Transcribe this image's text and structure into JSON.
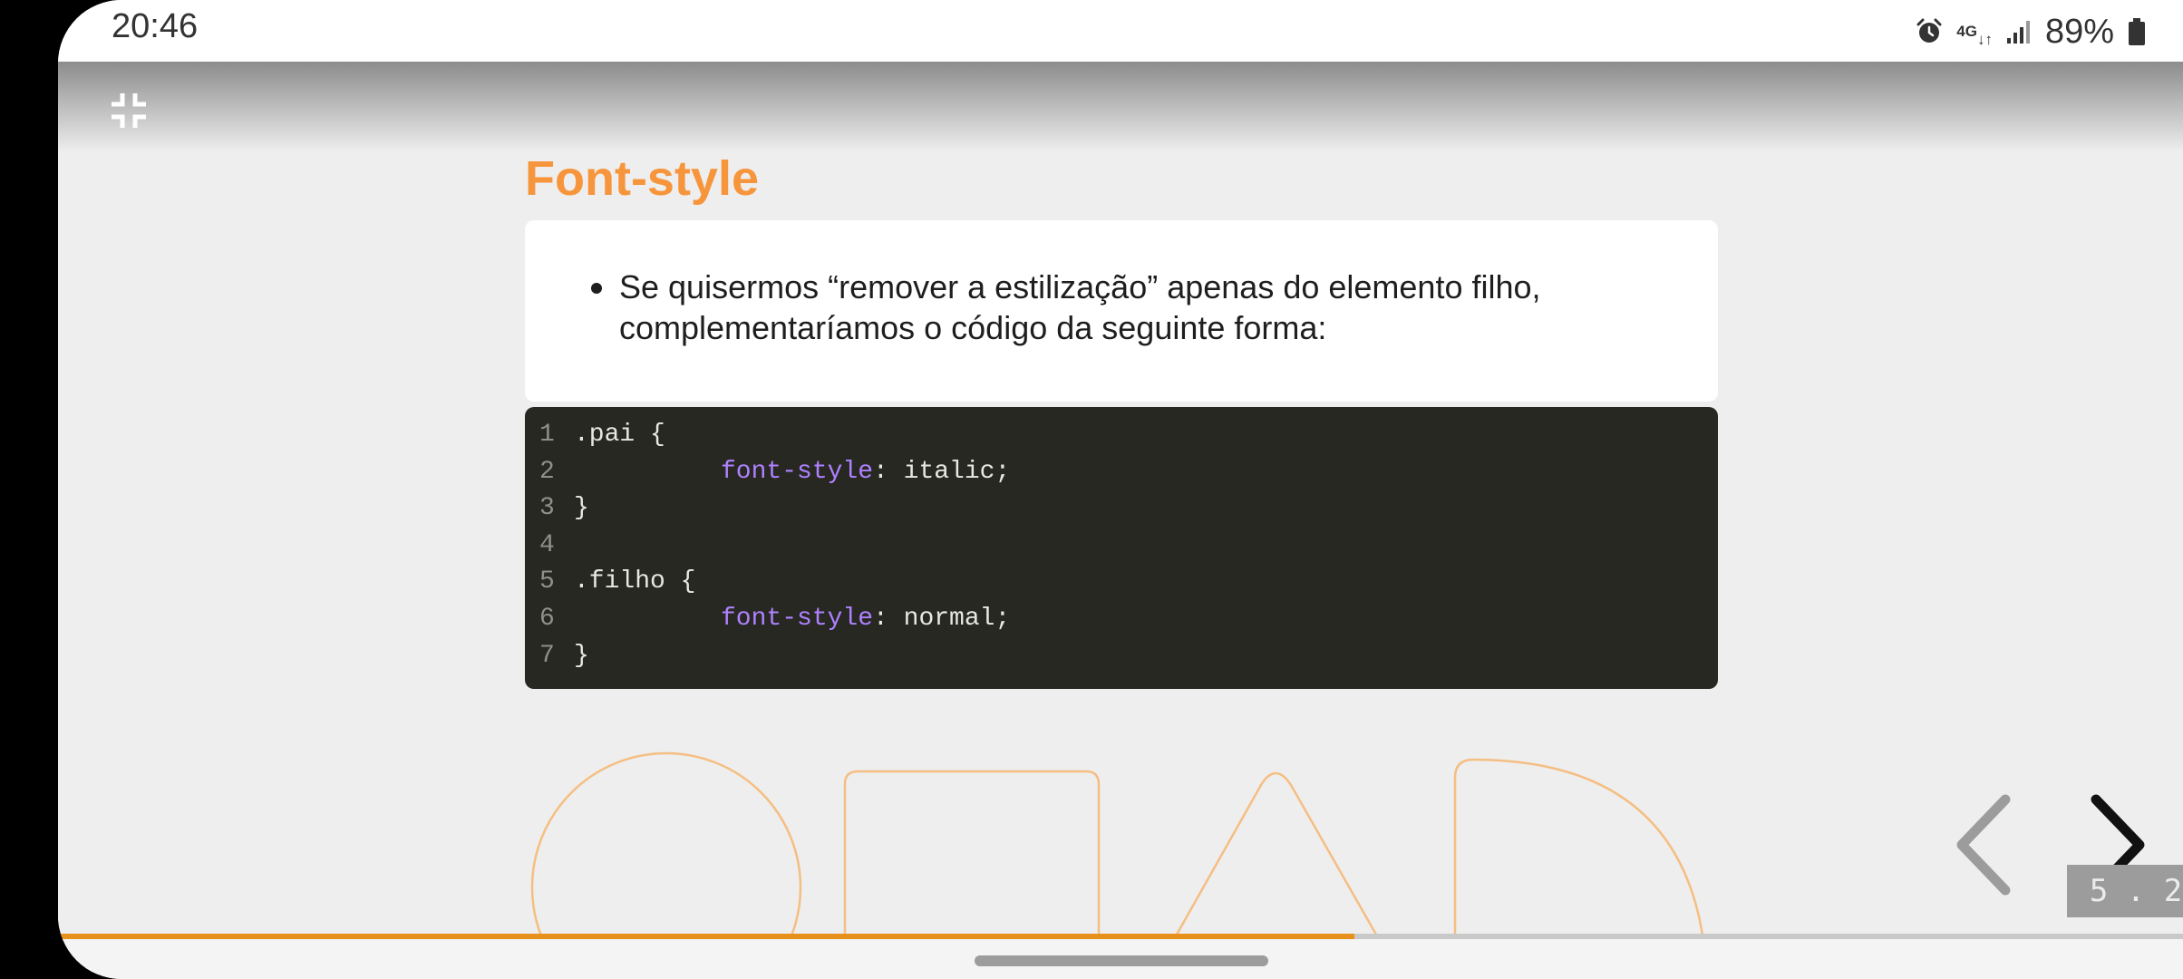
{
  "status_bar": {
    "time": "20:46",
    "network": "4G",
    "battery_percent": "89%",
    "icons": [
      "alarm-icon",
      "network-4g-icon",
      "signal-icon",
      "battery-icon"
    ]
  },
  "slide": {
    "title": "Font-style",
    "bullet_text_line1": "Se quisermos “remover a estilização” apenas do elemento filho,",
    "bullet_text_line2": "complementaríamos o código da seguinte forma:",
    "code": [
      {
        "num": "1",
        "indent": false,
        "text": ".pai {"
      },
      {
        "num": "2",
        "indent": true,
        "prop": "font-style",
        "rest": ": italic;"
      },
      {
        "num": "3",
        "indent": false,
        "text": "}"
      },
      {
        "num": "4",
        "indent": false,
        "text": ""
      },
      {
        "num": "5",
        "indent": false,
        "text": ".filho {"
      },
      {
        "num": "6",
        "indent": true,
        "prop": "font-style",
        "rest": ": normal;"
      },
      {
        "num": "7",
        "indent": false,
        "text": "}"
      }
    ],
    "counter": "5 . 2",
    "progress": 0.61
  },
  "colors": {
    "accent": "#f7953c",
    "progress": "#e8901c",
    "code_bg": "#272822",
    "code_prop": "#ae81ff"
  }
}
